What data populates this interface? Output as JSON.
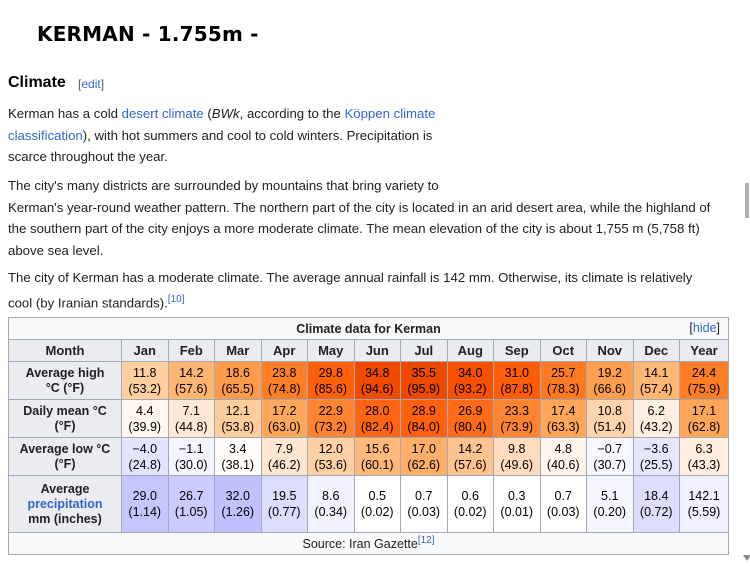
{
  "page_title": "KERMAN - 1.755m -",
  "section": {
    "heading": "Climate",
    "edit_open": "[",
    "edit_link": "edit",
    "edit_close": "]"
  },
  "paragraphs": {
    "p1_a": "Kerman has a cold ",
    "p1_link1": "desert climate",
    "p1_b": " (",
    "p1_italic": "BWk",
    "p1_c": ", according to the ",
    "p1_link2a": "Köppen climate",
    "p1_link2b": "classification",
    "p1_d": "), with hot summers and cool to cold winters. Precipitation is",
    "p1_e": "scarce throughout the year.",
    "p2_l1": "The city's many districts are surrounded by mountains that bring variety to",
    "p2_l2": "Kerman's year-round weather pattern. The northern part of the city is located in an arid desert area, while the highland of",
    "p2_l3": "the southern part of the city enjoys a more moderate climate. The mean elevation of the city is about 1,755 m (5,758 ft)",
    "p2_l4": "above sea level.",
    "p3_l1": "The city of Kerman has a moderate climate. The average annual rainfall is 142 mm. Otherwise, its climate is relatively",
    "p3_l2": "cool (by Iranian standards).",
    "p3_ref": "[10]"
  },
  "table": {
    "caption": "Climate data for Kerman",
    "hide_open": "[",
    "hide_link": "hide",
    "hide_close": "]",
    "month_header": "Month",
    "months": [
      "Jan",
      "Feb",
      "Mar",
      "Apr",
      "May",
      "Jun",
      "Jul",
      "Aug",
      "Sep",
      "Oct",
      "Nov",
      "Dec",
      "Year"
    ],
    "rows": [
      {
        "label_l1": "Average high",
        "label_l2": "°C (°F)",
        "c": [
          "11.8",
          "14.2",
          "18.6",
          "23.8",
          "29.8",
          "34.8",
          "35.5",
          "34.0",
          "31.0",
          "25.7",
          "19.2",
          "14.1",
          "24.4"
        ],
        "f": [
          "(53.2)",
          "(57.6)",
          "(65.5)",
          "(74.8)",
          "(85.6)",
          "(94.6)",
          "(95.9)",
          "(93.2)",
          "(87.8)",
          "(78.3)",
          "(66.6)",
          "(57.4)",
          "(75.9)"
        ],
        "colors": [
          "#ffcfa0",
          "#ffb672",
          "#ff9c4b",
          "#ff7f27",
          "#ff600b",
          "#f24b00",
          "#ed4800",
          "#f75000",
          "#ff5d07",
          "#ff7a22",
          "#ff9e4d",
          "#ffb776",
          "#ff7e25"
        ]
      },
      {
        "label_l1": "Daily mean °C",
        "label_l2": "(°F)",
        "c": [
          "4.4",
          "7.1",
          "12.1",
          "17.2",
          "22.9",
          "28.0",
          "28.9",
          "26.9",
          "23.3",
          "17.4",
          "10.8",
          "6.2",
          "17.1"
        ],
        "f": [
          "(39.9)",
          "(44.8)",
          "(53.8)",
          "(63.0)",
          "(73.2)",
          "(82.4)",
          "(84.0)",
          "(80.4)",
          "(73.9)",
          "(63.3)",
          "(51.4)",
          "(43.2)",
          "(62.8)"
        ],
        "colors": [
          "#fff7ef",
          "#ffe8d4",
          "#ffcc9c",
          "#ffa85c",
          "#ff8330",
          "#ff6413",
          "#ff610e",
          "#ff6c18",
          "#ff8431",
          "#ffa659",
          "#ffd3ab",
          "#ffefe0",
          "#ffa65b"
        ]
      },
      {
        "label_l1": "Average low °C",
        "label_l2": "(°F)",
        "c": [
          "−4.0",
          "−1.1",
          "3.4",
          "7.9",
          "12.0",
          "15.6",
          "17.0",
          "14.2",
          "9.8",
          "4.8",
          "−0.7",
          "−3.6",
          "6.3"
        ],
        "f": [
          "(24.8)",
          "(30.0)",
          "(38.1)",
          "(46.2)",
          "(53.6)",
          "(60.1)",
          "(62.6)",
          "(57.6)",
          "(49.6)",
          "(40.6)",
          "(30.7)",
          "(25.5)",
          "(43.3)"
        ],
        "colors": [
          "#e4e4ff",
          "#f5f5ff",
          "#fffcf9",
          "#ffe6d0",
          "#ffd0a6",
          "#ffb97d",
          "#ffaf69",
          "#ffc38f",
          "#ffdcbe",
          "#fff5ec",
          "#f7f7ff",
          "#e6e6ff",
          "#ffeedf"
        ]
      },
      {
        "label_l1": "Average",
        "label_link": "precipitation",
        "label_l3": "mm (inches)",
        "c": [
          "29.0",
          "26.7",
          "32.0",
          "19.5",
          "8.6",
          "0.5",
          "0.7",
          "0.6",
          "0.3",
          "0.7",
          "5.1",
          "18.4",
          "142.1"
        ],
        "f": [
          "(1.14)",
          "(1.05)",
          "(1.26)",
          "(0.77)",
          "(0.34)",
          "(0.02)",
          "(0.03)",
          "(0.02)",
          "(0.01)",
          "(0.03)",
          "(0.20)",
          "(0.72)",
          "(5.59)"
        ],
        "colors": [
          "#c6c6ff",
          "#cbcbff",
          "#c1c1ff",
          "#dcdcff",
          "#f1f1ff",
          "#ffffff",
          "#ffffff",
          "#ffffff",
          "#ffffff",
          "#ffffff",
          "#f6f6ff",
          "#ddddff",
          "#f0f0ff"
        ]
      }
    ],
    "source_text": "Source: Iran Gazette",
    "source_ref": "[12]"
  }
}
